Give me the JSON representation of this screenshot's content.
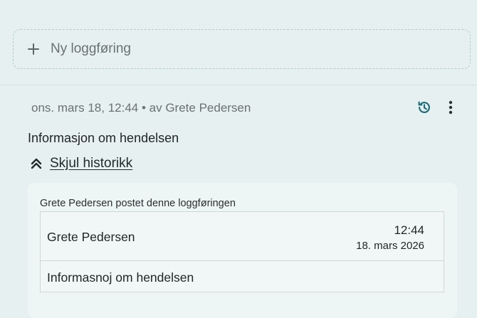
{
  "new_entry": {
    "label": "Ny loggføring",
    "icon": "plus-icon"
  },
  "entry": {
    "meta": "ons. mars 18, 12:44 • av Grete Pedersen",
    "text": "Informasjon om hendelsen",
    "history_icon": "history-icon",
    "menu_icon": "more-vertical-icon"
  },
  "history": {
    "toggle_label": "Skjul historikk",
    "toggle_icon": "chevrons-up-icon",
    "caption": "Grete Pedersen postet denne loggføringen",
    "author": "Grete Pedersen",
    "time": "12:44",
    "date": "18. mars 2026",
    "content": "Informasnoj om hendelsen"
  },
  "colors": {
    "background": "#e7f0f1",
    "accent": "#1f6f7a",
    "dashed_border": "#a9cfc6"
  }
}
